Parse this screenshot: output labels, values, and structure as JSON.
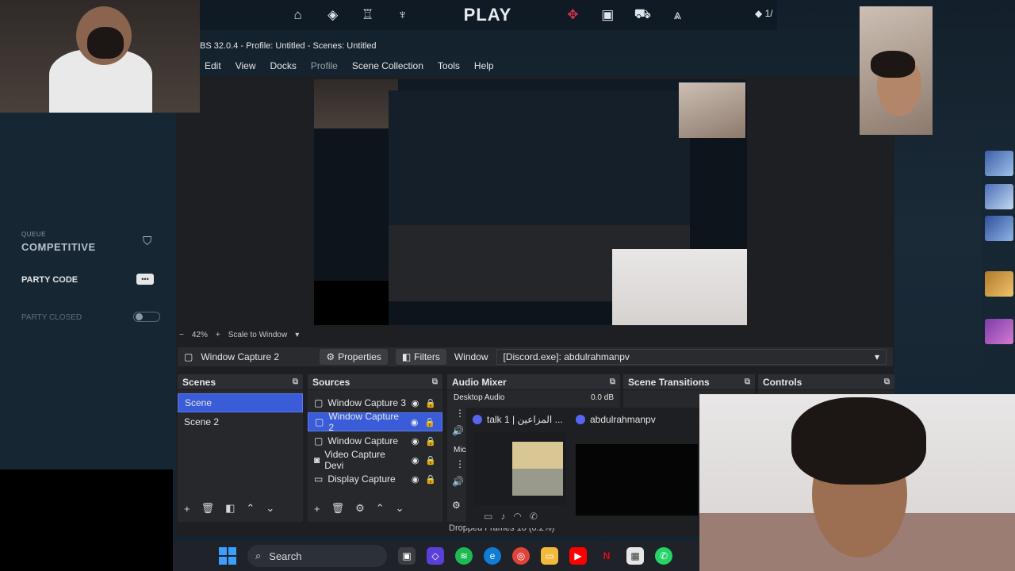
{
  "game": {
    "play_label": "PLAY",
    "vp_counter": "1/",
    "queue_label": "QUEUE",
    "queue_mode": "COMPETITIVE",
    "party_code_label": "PARTY CODE",
    "party_closed_label": "PARTY CLOSED",
    "nav_icons": [
      "home-icon",
      "tag-icon",
      "medal-icon",
      "trophy-icon",
      "crest-icon",
      "store-locker-icon",
      "cart-icon",
      "ranks-icon"
    ],
    "accent_red": "#d6324f"
  },
  "obs": {
    "title": "BS 32.0.4 - Profile: Untitled - Scenes: Untitled",
    "menu": [
      "Edit",
      "View",
      "Docks",
      "Profile",
      "Scene Collection",
      "Tools",
      "Help"
    ],
    "zoom": "42%",
    "scale_mode": "Scale to Window",
    "current_source": "Window Capture 2",
    "properties_label": "Properties",
    "filters_label": "Filters",
    "window_label": "Window",
    "window_value": "[Discord.exe]: abdulrahmanpv",
    "docks": {
      "scenes_title": "Scenes",
      "sources_title": "Sources",
      "audio_title": "Audio Mixer",
      "transitions_title": "Scene Transitions",
      "controls_title": "Controls"
    },
    "scenes": [
      "Scene",
      "Scene 2"
    ],
    "sources": [
      "Window Capture 3",
      "Window Capture 2",
      "Window Capture",
      "Video Capture Devi",
      "Display Capture"
    ],
    "audio": {
      "desktop_label": "Desktop Audio",
      "desktop_db": "0.0 dB",
      "mic_label": "Mic/"
    },
    "status_text": "Dropped Frames 10 (0.2%)",
    "accent_blue": "#3a5cd8"
  },
  "discord": {
    "tab1": "talk 1 | المزاعين ...",
    "tab2": "abdulrahmanpv"
  },
  "taskbar": {
    "search_label": "Search"
  }
}
